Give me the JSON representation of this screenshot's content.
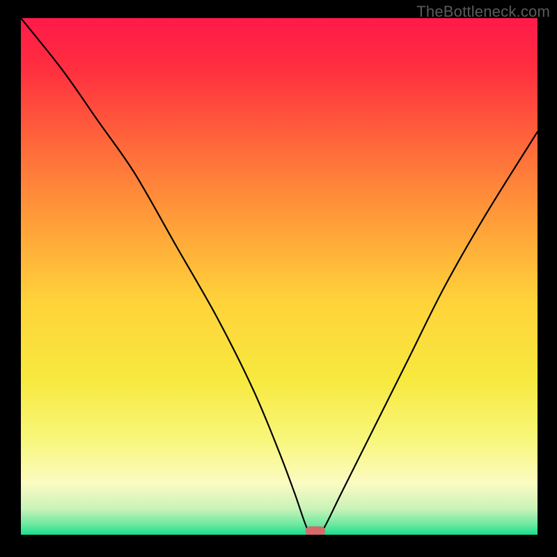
{
  "watermark": "TheBottleneck.com",
  "chart_data": {
    "type": "line",
    "title": "",
    "xlabel": "",
    "ylabel": "",
    "xlim": [
      0,
      100
    ],
    "ylim": [
      0,
      100
    ],
    "series": [
      {
        "name": "bottleneck-curve",
        "x": [
          0,
          8,
          15,
          22,
          30,
          38,
          45,
          50,
          53,
          55.5,
          57,
          58.5,
          62,
          68,
          75,
          82,
          90,
          100
        ],
        "values": [
          100,
          90,
          80,
          70,
          56,
          42,
          28,
          16,
          8,
          1,
          0,
          1,
          8,
          20,
          34,
          48,
          62,
          78
        ]
      }
    ],
    "marker": {
      "x": 57,
      "y": 0,
      "color": "#d46a6a"
    },
    "background_gradient": {
      "stops": [
        {
          "offset": 0.0,
          "color": "#ff1a4a"
        },
        {
          "offset": 0.1,
          "color": "#ff2f3f"
        },
        {
          "offset": 0.25,
          "color": "#ff6a3a"
        },
        {
          "offset": 0.4,
          "color": "#ffa039"
        },
        {
          "offset": 0.55,
          "color": "#ffd33a"
        },
        {
          "offset": 0.7,
          "color": "#f7e93e"
        },
        {
          "offset": 0.82,
          "color": "#f8f77e"
        },
        {
          "offset": 0.9,
          "color": "#fbfbc2"
        },
        {
          "offset": 0.95,
          "color": "#c9f3b8"
        },
        {
          "offset": 0.98,
          "color": "#6de9a0"
        },
        {
          "offset": 1.0,
          "color": "#17df8f"
        }
      ]
    }
  }
}
